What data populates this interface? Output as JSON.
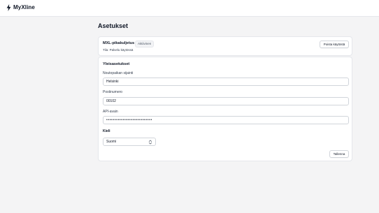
{
  "app": {
    "name": "MyXline",
    "brand_icon": "bolt-icon",
    "accent": "#111827"
  },
  "page": {
    "title": "Asetukset"
  },
  "service": {
    "name": "MXL-pikakuljetus",
    "badge": "Aktiivinen",
    "status": "Tila: Palvelu käytössä",
    "disable_label": "Poista käytöstä"
  },
  "settings": {
    "section_title": "Yleisasetukset",
    "pickup_location": {
      "label": "Noutopaikan sijainti",
      "value": "Helsinki"
    },
    "postal_code": {
      "label": "Postinumero",
      "value": "00102"
    },
    "api_key": {
      "label": "API-avain",
      "value": "••••••••••••••••••••••••••••"
    },
    "language": {
      "label": "Kieli",
      "selected": "Suomi",
      "icon": "chevron-up-down-icon"
    },
    "save_label": "Tallenna"
  }
}
